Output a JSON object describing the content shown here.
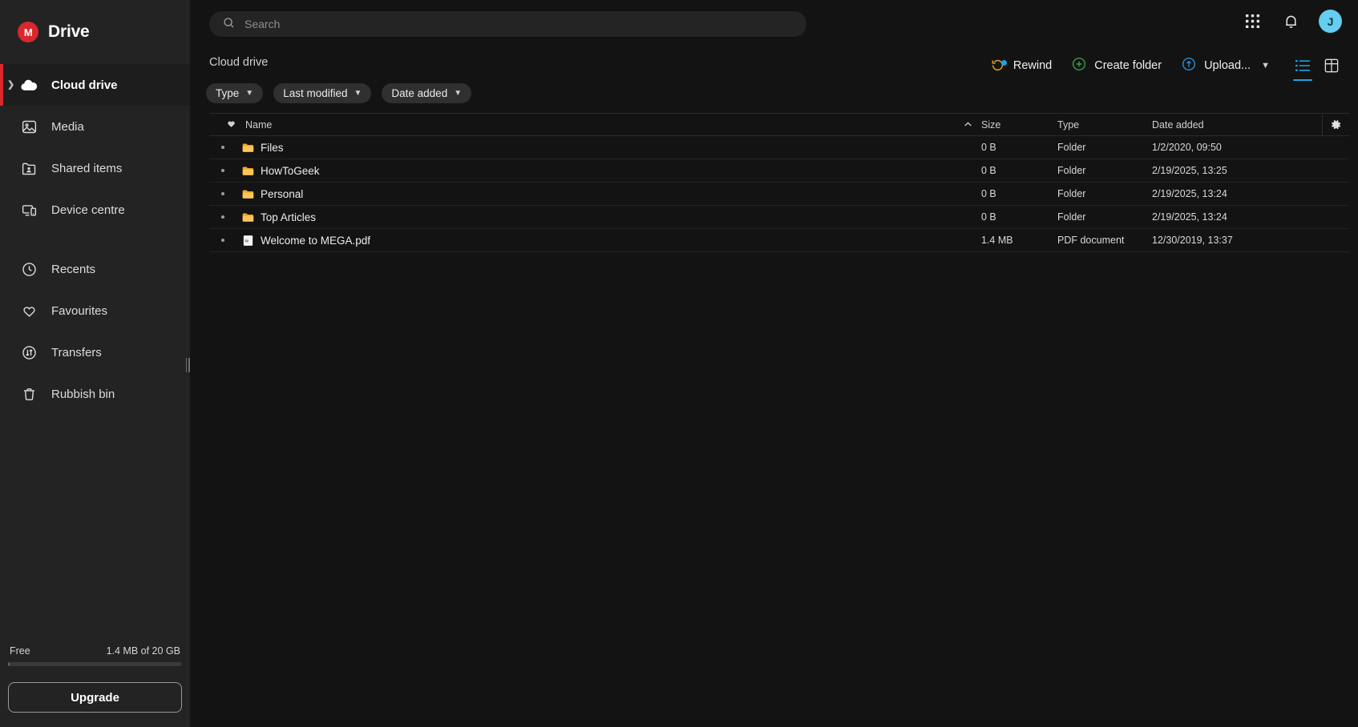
{
  "brand": {
    "logo_letter": "M",
    "title": "Drive",
    "logo_color": "#d9272e"
  },
  "search": {
    "placeholder": "Search",
    "value": "",
    "icon": "search-icon"
  },
  "topbar": {
    "apps_icon": "grid-apps-icon",
    "notifications_icon": "bell-icon",
    "avatar_initial": "J",
    "avatar_color": "#64cdf0"
  },
  "sidebar": {
    "items": [
      {
        "label": "Cloud drive",
        "icon": "cloud-icon",
        "active": true,
        "expandable": true
      },
      {
        "label": "Media",
        "icon": "image-icon",
        "active": false
      },
      {
        "label": "Shared items",
        "icon": "shared-folder-icon",
        "active": false
      },
      {
        "label": "Device centre",
        "icon": "device-icon",
        "active": false
      },
      {
        "label": "Recents",
        "icon": "clock-icon",
        "active": false
      },
      {
        "label": "Favourites",
        "icon": "heart-icon",
        "active": false
      },
      {
        "label": "Transfers",
        "icon": "transfers-icon",
        "active": false
      },
      {
        "label": "Rubbish bin",
        "icon": "trash-icon",
        "active": false
      }
    ],
    "storage": {
      "plan_label": "Free",
      "usage_text": "1.4 MB of 20 GB",
      "percent_used": 1
    },
    "upgrade_label": "Upgrade"
  },
  "breadcrumb": {
    "path": "Cloud drive"
  },
  "filters": [
    {
      "label": "Type",
      "icon": "chevron-down-icon"
    },
    {
      "label": "Last modified",
      "icon": "chevron-down-icon"
    },
    {
      "label": "Date added",
      "icon": "chevron-down-icon"
    }
  ],
  "toolbar": {
    "rewind_label": "Rewind",
    "rewind_icon": "rewind-icon",
    "rewind_badge": true,
    "rewind_color": "#d8a21e",
    "create_folder_label": "Create folder",
    "create_folder_icon": "plus-circle-icon",
    "create_folder_color": "#3a9c52",
    "upload_label": "Upload...",
    "upload_icon": "upload-circle-icon",
    "upload_color": "#2a8fd4",
    "upload_caret": "chevron-down-icon",
    "list_view_icon": "list-view-icon",
    "grid_view_icon": "grid-view-icon",
    "active_view": "list",
    "active_view_color": "#1aa3e8"
  },
  "table": {
    "columns": {
      "favourite_icon": "heart-filled-icon",
      "name": "Name",
      "sort_icon": "caret-up-icon",
      "size": "Size",
      "type": "Type",
      "date_added": "Date added",
      "settings_icon": "gear-icon"
    },
    "rows": [
      {
        "name": "Files",
        "icon": "folder-icon",
        "size": "0 B",
        "type": "Folder",
        "date": "1/2/2020, 09:50"
      },
      {
        "name": "HowToGeek",
        "icon": "folder-icon",
        "size": "0 B",
        "type": "Folder",
        "date": "2/19/2025, 13:25"
      },
      {
        "name": "Personal",
        "icon": "folder-icon",
        "size": "0 B",
        "type": "Folder",
        "date": "2/19/2025, 13:24"
      },
      {
        "name": "Top Articles",
        "icon": "folder-icon",
        "size": "0 B",
        "type": "Folder",
        "date": "2/19/2025, 13:24"
      },
      {
        "name": "Welcome to MEGA.pdf",
        "icon": "pdf-icon",
        "size": "1.4 MB",
        "type": "PDF document",
        "date": "12/30/2019, 13:37"
      }
    ]
  }
}
